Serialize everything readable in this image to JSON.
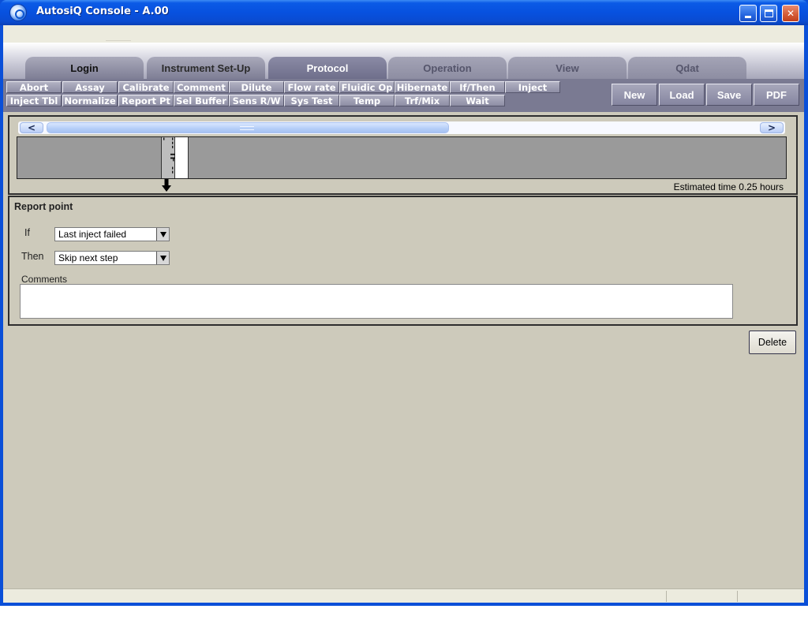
{
  "window": {
    "title": "AutosiQ Console - A.00"
  },
  "tabs": {
    "login": "Login",
    "instrument_setup": "Instrument Set-Up",
    "protocol": "Protocol",
    "operation": "Operation",
    "view": "View",
    "qdat": "Qdat"
  },
  "commands": {
    "row1": [
      "Abort",
      "Assay",
      "Calibrate",
      "Comment",
      "Dilute",
      "Flow rate",
      "Fluidic Op",
      "Hibernate",
      "If/Then",
      "Inject"
    ],
    "row2": [
      "Inject Tbl",
      "Normalize",
      "Report Pt",
      "Sel Buffer",
      "Sens R/W",
      "Sys Test",
      "Temp",
      "Trf/Mix",
      "Wait"
    ]
  },
  "actions": {
    "new": "New",
    "load": "Load",
    "save": "Save",
    "pdf": "PDF"
  },
  "timeline": {
    "scroll_left": "<",
    "scroll_right": ">",
    "step_label": "--- IF ---",
    "estimated_time": "Estimated time 0.25 hours"
  },
  "detail": {
    "title": "Report point",
    "if_label": "If",
    "if_value": "Last inject failed",
    "then_label": "Then",
    "then_value": "Skip next step",
    "comments_label": "Comments",
    "comments_value": ""
  },
  "delete_label": "Delete",
  "colors": {
    "titlebar": "#0a4fd8",
    "client": "#cdcabb",
    "toolbar": "#7a7a92"
  },
  "icons": {
    "app": "autosiq-logo-icon",
    "minimize": "minimize-icon",
    "maximize": "maximize-icon",
    "close": "close-icon",
    "marker": "down-arrow-icon"
  }
}
